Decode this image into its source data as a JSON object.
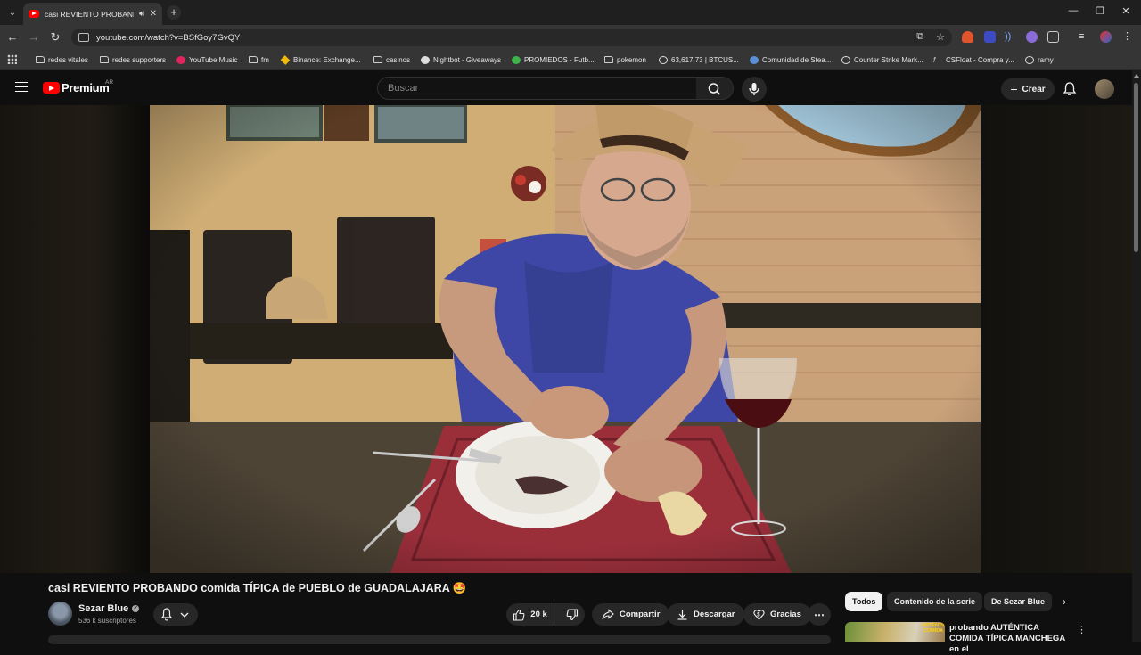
{
  "browser": {
    "tab_title": "casi REVIENTO PROBANDO",
    "url": "youtube.com/watch?v=BSfGoy7GvQY",
    "bookmarks": [
      {
        "label": "redes vitales",
        "icon": "folder-icon"
      },
      {
        "label": "redes supporters",
        "icon": "folder-icon"
      },
      {
        "label": "YouTube Music",
        "icon": "youtube-music-icon"
      },
      {
        "label": "fm",
        "icon": "folder-icon"
      },
      {
        "label": "Binance: Exchange...",
        "icon": "binance-icon"
      },
      {
        "label": "casinos",
        "icon": "folder-icon"
      },
      {
        "label": "Nightbot - Giveaways",
        "icon": "nightbot-icon"
      },
      {
        "label": "PROMIEDOS - Futb...",
        "icon": "promiedos-icon"
      },
      {
        "label": "pokemon",
        "icon": "folder-icon"
      },
      {
        "label": "63,617.73 | BTCUS...",
        "icon": "tradingview-icon"
      },
      {
        "label": "Comunidad de Stea...",
        "icon": "steam-icon"
      },
      {
        "label": "Counter Strike Mark...",
        "icon": "csmarket-icon"
      },
      {
        "label": "CSFloat - Compra y...",
        "icon": "csfloat-icon"
      },
      {
        "label": "ramy",
        "icon": "globe-icon"
      }
    ]
  },
  "youtube": {
    "premium_label": "Premium",
    "country_code": "AR",
    "search_placeholder": "Buscar",
    "create_label": "Crear"
  },
  "video": {
    "title": "casi REVIENTO PROBANDO comida TÍPICA de PUEBLO de GUADALAJARA 🤩",
    "channel_name": "Sezar Blue",
    "subscribers": "536 k suscriptores",
    "likes": "20 k",
    "actions": {
      "share": "Compartir",
      "download": "Descargar",
      "thanks": "Gracias"
    }
  },
  "sidebar": {
    "chips": [
      "Todos",
      "Contenido de la serie",
      "De Sezar Blue"
    ],
    "recommendation": {
      "title": "probando AUTÉNTICA COMIDA TÍPICA MANCHEGA en el",
      "thumb_tag": "AUTÉNTICA COMIDA"
    }
  },
  "colors": {
    "background": "#0f0f0f",
    "youtube_red": "#ff0000",
    "pill_bg": "#272727",
    "chip_active_bg": "#f1f1f1"
  }
}
